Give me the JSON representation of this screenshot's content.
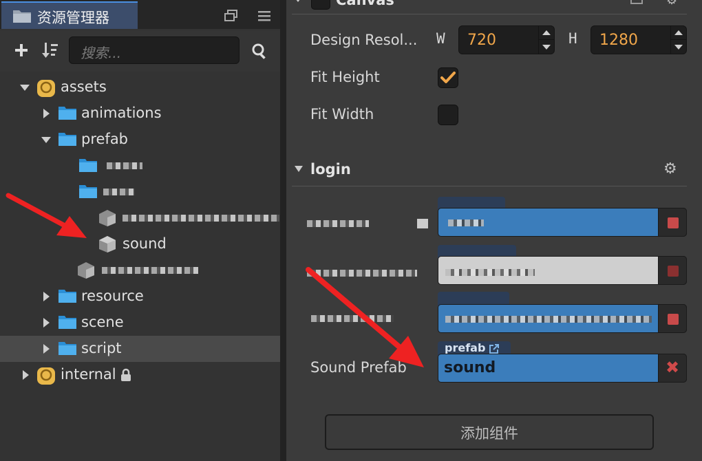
{
  "assets_panel": {
    "title": "资源管理器",
    "search_placeholder": "搜索...",
    "tree": {
      "assets": "assets",
      "animations": "animations",
      "prefab": "prefab",
      "sound": "sound",
      "resource": "resource",
      "scene": "scene",
      "script": "script",
      "internal": "internal"
    }
  },
  "inspector": {
    "canvas_header": "Canvas",
    "design_resolution_label": "Design Resol...",
    "w_label": "W",
    "width_value": "720",
    "h_label": "H",
    "height_value": "1280",
    "fit_height_label": "Fit Height",
    "fit_height_checked": true,
    "fit_width_label": "Fit Width",
    "fit_width_checked": false,
    "login_header": "login",
    "sound_prefab_label": "Sound Prefab",
    "sound_prefab_tag": "prefab",
    "sound_prefab_value": "sound",
    "add_component_label": "添加组件"
  },
  "colors": {
    "accent_blue": "#3c7db8",
    "checkbox_orange": "#f0a64a",
    "number_text": "#f0a64a",
    "remove_red": "#c84a4a"
  }
}
